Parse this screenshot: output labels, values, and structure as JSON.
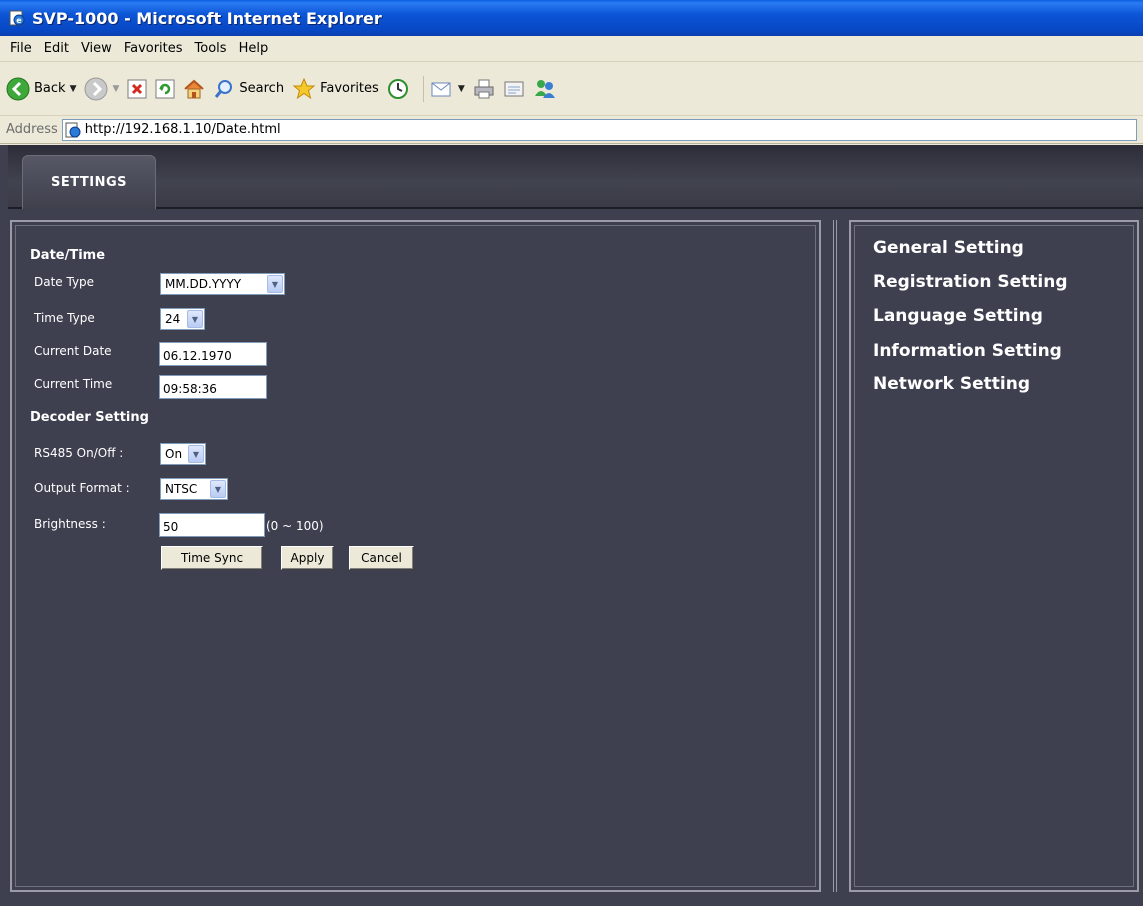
{
  "window": {
    "title": "SVP-1000 - Microsoft Internet Explorer"
  },
  "menubar": {
    "items": [
      "File",
      "Edit",
      "View",
      "Favorites",
      "Tools",
      "Help"
    ]
  },
  "toolbar": {
    "back_label": "Back",
    "search_label": "Search",
    "favorites_label": "Favorites"
  },
  "address": {
    "label": "Address",
    "url": "http://192.168.1.10/Date.html"
  },
  "tabs": {
    "active": "SETTINGS"
  },
  "form": {
    "datetime_title": "Date/Time",
    "date_type_label": "Date Type",
    "date_type_value": "MM.DD.YYYY",
    "time_type_label": "Time Type",
    "time_type_value": "24",
    "current_date_label": "Current Date",
    "current_date_value": "06.12.1970",
    "current_time_label": "Current Time",
    "current_time_value": "09:58:36",
    "decoder_title": "Decoder Setting",
    "rs485_label": "RS485 On/Off :",
    "rs485_value": "On",
    "output_format_label": "Output Format :",
    "output_format_value": "NTSC",
    "brightness_label": "Brightness :",
    "brightness_value": "50",
    "brightness_range": "(0 ~ 100)",
    "time_sync_label": "Time Sync",
    "apply_label": "Apply",
    "cancel_label": "Cancel"
  },
  "nav": {
    "items": [
      "General Setting",
      "Registration Setting",
      "Language Setting",
      "Information Setting",
      "Network Setting"
    ]
  },
  "colors": {
    "page_bg": "#3e3f4f",
    "titlebar": "#0b55d6",
    "chrome": "#ece9d8"
  }
}
